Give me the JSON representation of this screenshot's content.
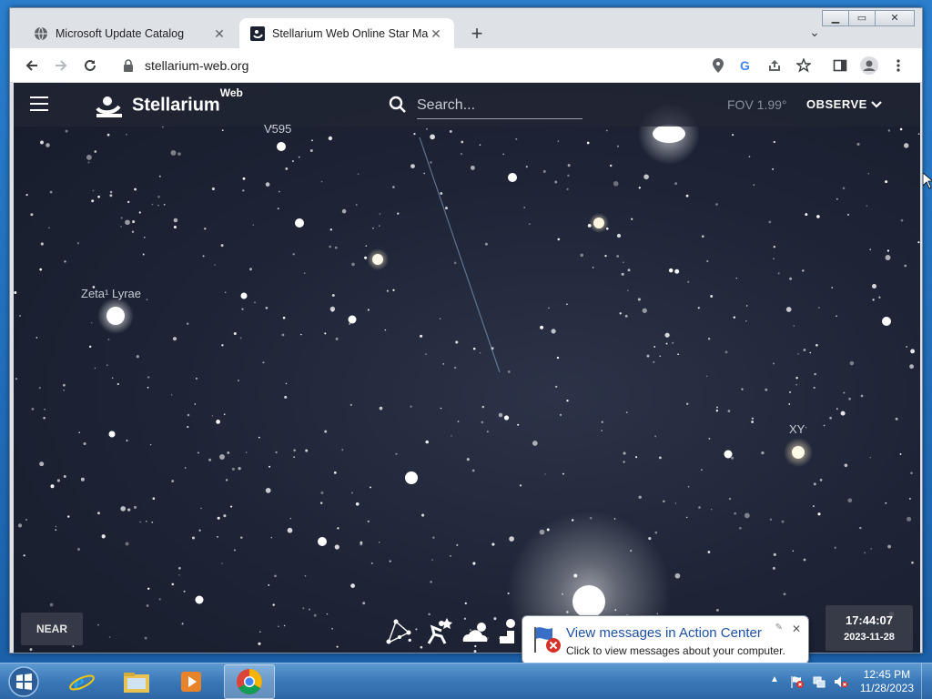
{
  "browser": {
    "tabs": [
      {
        "title": "Microsoft Update Catalog",
        "icon": "globe-icon",
        "active": false
      },
      {
        "title": "Stellarium Web Online Star Map",
        "icon": "stellarium-icon",
        "active": true
      }
    ],
    "new_tab_symbol": "+",
    "url": "stellarium-web.org",
    "window_controls": {
      "minimize": "▭",
      "maximize": "▢",
      "close": "✕"
    }
  },
  "app": {
    "brand": "Stellarium",
    "brand_sup": "Web",
    "search_placeholder": "Search...",
    "fov": "FOV 1.99°",
    "observe_label": "OBSERVE",
    "near_label": "NEAR",
    "time": "17:44:07",
    "date": "2023-11-28"
  },
  "sky_labels": {
    "v595": "V595",
    "zeta_lyrae": "Zeta¹ Lyrae",
    "xy": "XY"
  },
  "notification": {
    "title": "View messages in Action Center",
    "text": "Click to view messages about your computer."
  },
  "taskbar": {
    "apps": [
      "internet-explorer-icon",
      "file-explorer-icon",
      "media-player-icon",
      "chrome-icon"
    ],
    "clock_time": "12:45 PM",
    "clock_date": "11/28/2023"
  },
  "colors": {
    "sky": "#1e2436",
    "app_bar": "#212634",
    "taskbar": "#3a78b8",
    "balloon_title": "#1e50a2"
  }
}
